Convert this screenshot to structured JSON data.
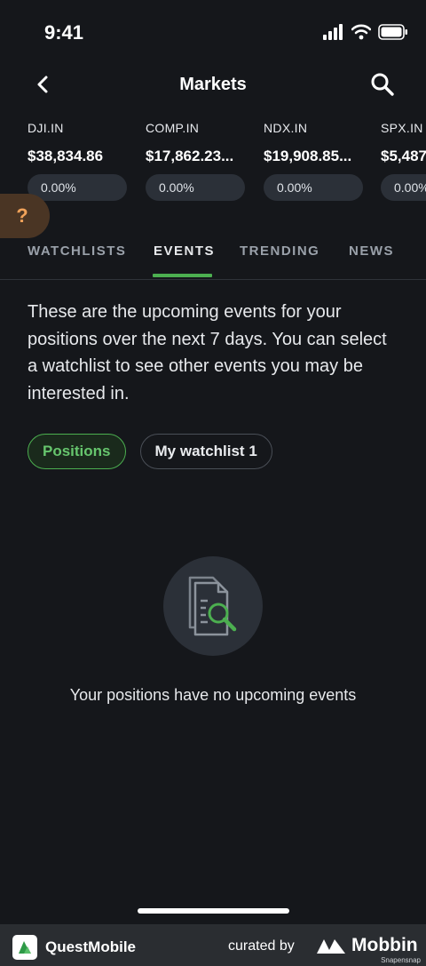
{
  "status": {
    "time": "9:41"
  },
  "nav": {
    "title": "Markets"
  },
  "tickers": [
    {
      "symbol": "DJI.IN",
      "price": "$38,834.86",
      "change": "0.00%"
    },
    {
      "symbol": "COMP.IN",
      "price": "$17,862.23...",
      "change": "0.00%"
    },
    {
      "symbol": "NDX.IN",
      "price": "$19,908.85...",
      "change": "0.00%"
    },
    {
      "symbol": "SPX.IN",
      "price": "$5,487",
      "change": "0.00%"
    }
  ],
  "help": {
    "label": "?"
  },
  "tabs": [
    "WATCHLISTS",
    "EVENTS",
    "TRENDING",
    "NEWS"
  ],
  "description": "These are the upcoming events for your positions over the next 7 days. You can select a watchlist to see other events you may be interested in.",
  "chips": [
    "Positions",
    "My watchlist 1"
  ],
  "empty": {
    "message": "Your positions have no upcoming events"
  },
  "footer": {
    "brand": "QuestMobile",
    "curated": "curated by",
    "mobbin": "Mobbin",
    "credit": "Snapensnap"
  },
  "colors": {
    "accent": "#4caf50",
    "background": "#15171b",
    "help": "#f0a25a"
  }
}
